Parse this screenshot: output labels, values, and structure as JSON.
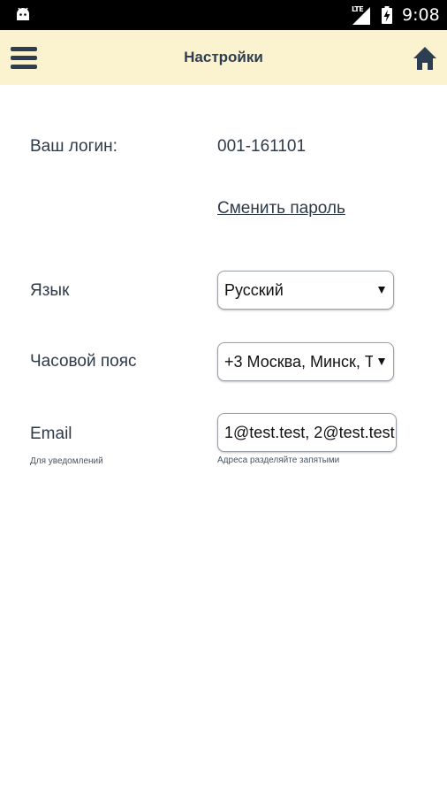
{
  "status_bar": {
    "network": "LTE",
    "time": "9:08"
  },
  "app_bar": {
    "title": "Настройки",
    "menu_icon": "hamburger-menu-icon",
    "home_icon": "home-icon"
  },
  "settings": {
    "login": {
      "label": "Ваш логин:",
      "value": "001-161101"
    },
    "change_password": {
      "label": "Сменить пароль"
    },
    "language": {
      "label": "Язык",
      "selected": "Русский"
    },
    "timezone": {
      "label": "Часовой пояс",
      "selected": "+3 Москва, Минск, Т"
    },
    "email": {
      "label": "Email",
      "sub_hint": "Для уведомлений",
      "value": "1@test.test, 2@test.test",
      "hint": "Адреса разделяйте запятыми"
    }
  },
  "colors": {
    "app_bar_bg": "#fbf3cf",
    "primary_text": "#2e3e52",
    "status_bar_bg": "#000000"
  }
}
